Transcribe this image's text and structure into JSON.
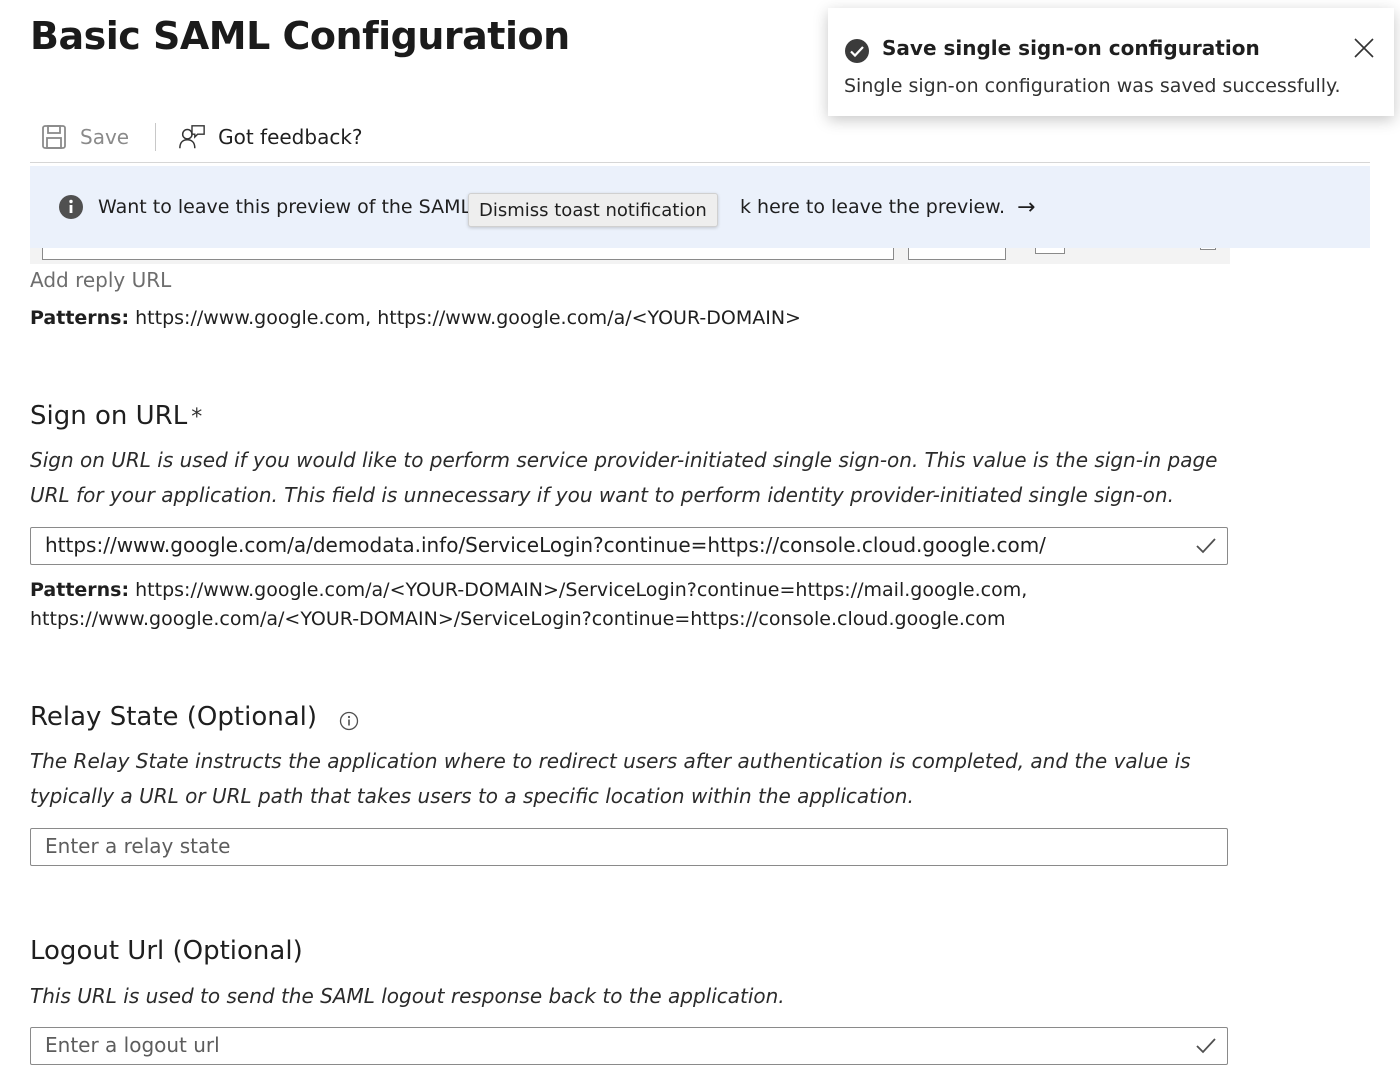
{
  "page": {
    "title": "Basic SAML Configuration"
  },
  "toolbar": {
    "save_label": "Save",
    "feedback_label": "Got feedback?"
  },
  "banner": {
    "text_before": "Want to leave this preview of the SAML Co",
    "text_after": "k here to leave the preview.",
    "arrow": "→"
  },
  "tooltip": {
    "text": "Dismiss toast notification"
  },
  "reply_url": {
    "add_link": "Add reply URL",
    "patterns_label": "Patterns:",
    "patterns_text": "https://www.google.com, https://www.google.com/a/<YOUR-DOMAIN>"
  },
  "sign_on_url": {
    "label": "Sign on URL",
    "required_mark": "*",
    "description": "Sign on URL is used if you would like to perform service provider-initiated single sign-on. This value is the sign-in page URL for your application. This field is unnecessary if you want to perform identity provider-initiated single sign-on.",
    "value": "https://www.google.com/a/demodata.info/ServiceLogin?continue=https://console.cloud.google.com/",
    "patterns_label": "Patterns:",
    "patterns_line1": "https://www.google.com/a/<YOUR-DOMAIN>/ServiceLogin?continue=https://mail.google.com,",
    "patterns_line2": "https://www.google.com/a/<YOUR-DOMAIN>/ServiceLogin?continue=https://console.cloud.google.com"
  },
  "relay_state": {
    "label": "Relay State (Optional)",
    "description": "The Relay State instructs the application where to redirect users after authentication is completed, and the value is typically a URL or URL path that takes users to a specific location within the application.",
    "placeholder": "Enter a relay state",
    "value": ""
  },
  "logout_url": {
    "label": "Logout Url (Optional)",
    "description": "This URL is used to send the SAML logout response back to the application.",
    "placeholder": "Enter a logout url",
    "value": ""
  },
  "toast": {
    "title": "Save single sign-on configuration",
    "message": "Single sign-on configuration was saved successfully."
  },
  "colors": {
    "banner_bg": "#ebf1fb",
    "success_icon": "#3b3b3b",
    "valid_check": "#505050"
  },
  "icons": {
    "save": "save-icon",
    "feedback": "feedback-icon",
    "info": "info-icon",
    "check": "checkmark-icon",
    "close": "close-icon",
    "success": "success-check-icon"
  }
}
